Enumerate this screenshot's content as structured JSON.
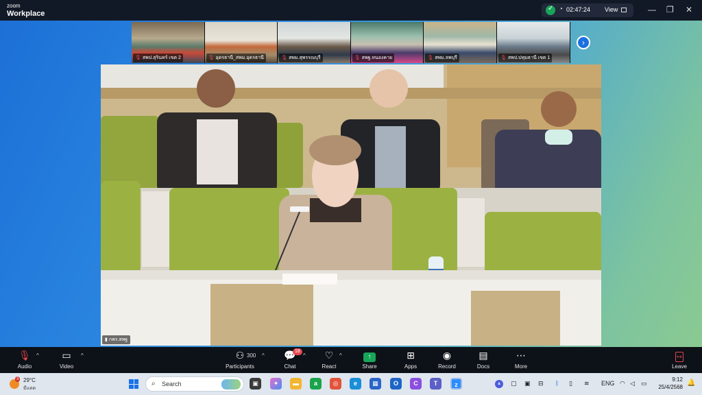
{
  "titlebar": {
    "brand_small": "zoom",
    "brand_big": "Workplace",
    "timer": "02:47:24",
    "view_label": "View",
    "controls": [
      "—",
      "❐",
      "✕"
    ],
    "shield_icon": "shield-check-icon",
    "accent": "#18a558"
  },
  "thumbnails": [
    {
      "label": "สพป.สุรินทร์ เขต 2"
    },
    {
      "label": "อุดรธานี_สพม.อุดรธานี"
    },
    {
      "label": "สพม.สุพรรณบุรี"
    },
    {
      "label": "สพฐ.หนองคาย"
    },
    {
      "label": "สพม.ลพบุรี"
    },
    {
      "label": "สพป.ปทุมธานี เขต 1"
    }
  ],
  "main_video": {
    "label": "กพร.สพฐ"
  },
  "toolbar": {
    "audio": "Audio",
    "video": "Video",
    "participants": "Participants",
    "participants_count": "300",
    "chat": "Chat",
    "chat_badge": "18",
    "react": "React",
    "share": "Share",
    "apps": "Apps",
    "record": "Record",
    "docs": "Docs",
    "more": "More",
    "leave": "Leave"
  },
  "taskbar": {
    "temperature": "29°C",
    "weather_badge": "3",
    "weather_desc": "มีแดด",
    "search_placeholder": "Search",
    "lang": "ENG",
    "time": "9:12",
    "date": "25/4/2568"
  }
}
